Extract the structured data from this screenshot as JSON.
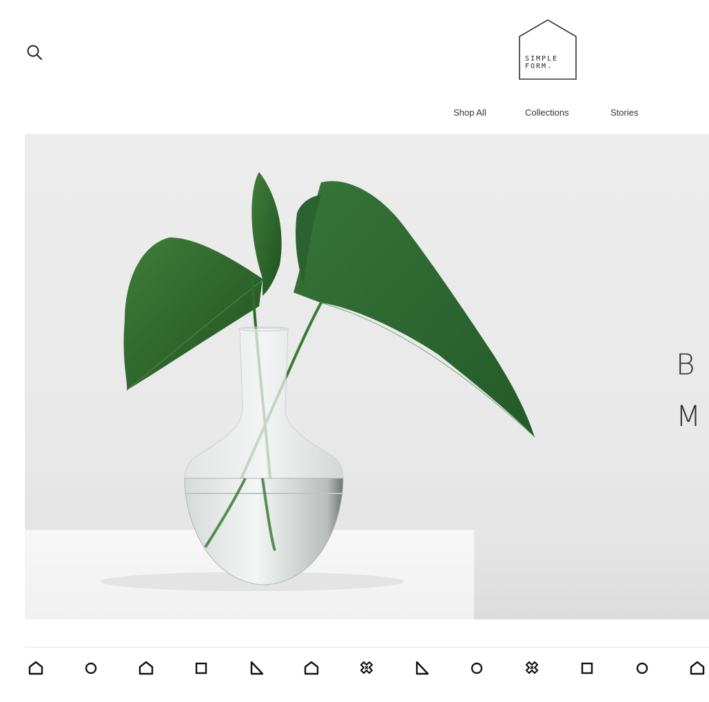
{
  "brand": {
    "line1": "SIMPLE",
    "line2": "FORM."
  },
  "header": {
    "search_icon": "search-icon"
  },
  "nav": {
    "items": [
      {
        "label": "Shop All"
      },
      {
        "label": "Collections"
      },
      {
        "label": "Stories"
      }
    ]
  },
  "hero": {
    "letters": [
      "B",
      "M"
    ],
    "image": "plant-in-glass-vase"
  },
  "shape_strip": {
    "icons": [
      "house-icon",
      "circle-icon",
      "house-icon",
      "square-icon",
      "triangle-icon",
      "house-icon",
      "cross-icon",
      "triangle-icon",
      "circle-icon",
      "cross-icon",
      "square-icon",
      "circle-icon",
      "house-icon"
    ]
  },
  "colors": {
    "ink": "#1a1a1a",
    "leaf": "#2f6b2c",
    "backdrop": "#ebebeb"
  }
}
